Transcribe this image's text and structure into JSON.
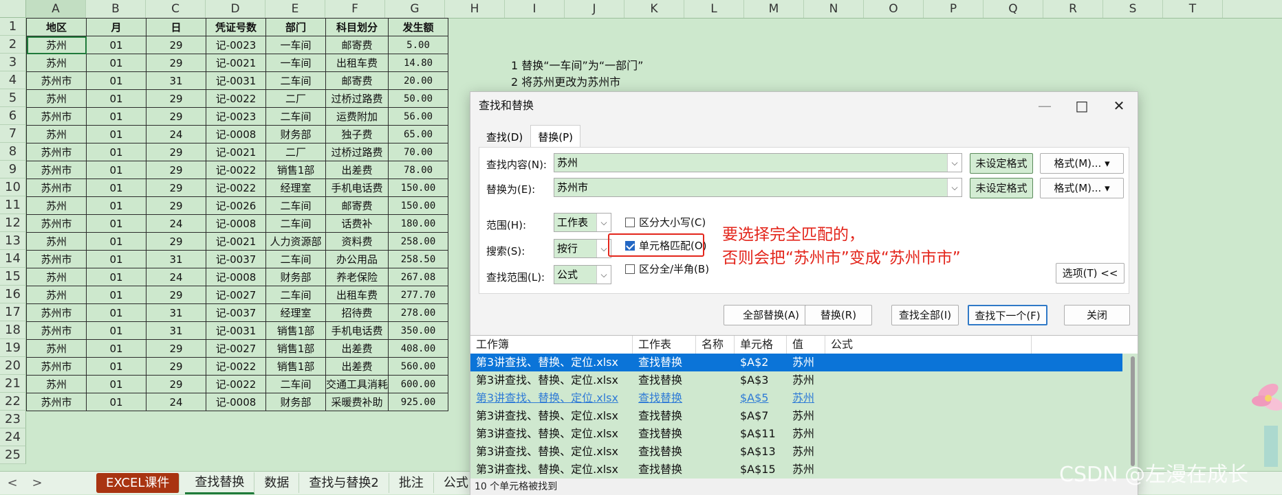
{
  "columns": [
    "A",
    "B",
    "C",
    "D",
    "E",
    "F",
    "G",
    "H",
    "I",
    "J",
    "K",
    "L",
    "M",
    "N",
    "O",
    "P",
    "Q",
    "R",
    "S",
    "T"
  ],
  "rows": [
    "1",
    "2",
    "3",
    "4",
    "5",
    "6",
    "7",
    "8",
    "9",
    "10",
    "11",
    "12",
    "13",
    "14",
    "15",
    "16",
    "17",
    "18",
    "19",
    "20",
    "21",
    "22",
    "23",
    "24",
    "25"
  ],
  "table": {
    "headers": [
      "地区",
      "月",
      "日",
      "凭证号数",
      "部门",
      "科目划分",
      "发生额"
    ],
    "rows": [
      [
        "苏州",
        "01",
        "29",
        "记-0023",
        "一车间",
        "邮寄费",
        "5.00"
      ],
      [
        "苏州",
        "01",
        "29",
        "记-0021",
        "一车间",
        "出租车费",
        "14.80"
      ],
      [
        "苏州市",
        "01",
        "31",
        "记-0031",
        "二车间",
        "邮寄费",
        "20.00"
      ],
      [
        "苏州",
        "01",
        "29",
        "记-0022",
        "二厂",
        "过桥过路费",
        "50.00"
      ],
      [
        "苏州市",
        "01",
        "29",
        "记-0023",
        "二车间",
        "运费附加",
        "56.00"
      ],
      [
        "苏州",
        "01",
        "24",
        "记-0008",
        "财务部",
        "独子费",
        "65.00"
      ],
      [
        "苏州市",
        "01",
        "29",
        "记-0021",
        "二厂",
        "过桥过路费",
        "70.00"
      ],
      [
        "苏州市",
        "01",
        "29",
        "记-0022",
        "销售1部",
        "出差费",
        "78.00"
      ],
      [
        "苏州市",
        "01",
        "29",
        "记-0022",
        "经理室",
        "手机电话费",
        "150.00"
      ],
      [
        "苏州",
        "01",
        "29",
        "记-0026",
        "二车间",
        "邮寄费",
        "150.00"
      ],
      [
        "苏州市",
        "01",
        "24",
        "记-0008",
        "二车间",
        "话费补",
        "180.00"
      ],
      [
        "苏州",
        "01",
        "29",
        "记-0021",
        "人力资源部",
        "资料费",
        "258.00"
      ],
      [
        "苏州市",
        "01",
        "31",
        "记-0037",
        "二车间",
        "办公用品",
        "258.50"
      ],
      [
        "苏州",
        "01",
        "24",
        "记-0008",
        "财务部",
        "养老保险",
        "267.08"
      ],
      [
        "苏州",
        "01",
        "29",
        "记-0027",
        "二车间",
        "出租车费",
        "277.70"
      ],
      [
        "苏州市",
        "01",
        "31",
        "记-0037",
        "经理室",
        "招待费",
        "278.00"
      ],
      [
        "苏州市",
        "01",
        "31",
        "记-0031",
        "销售1部",
        "手机电话费",
        "350.00"
      ],
      [
        "苏州",
        "01",
        "29",
        "记-0027",
        "销售1部",
        "出差费",
        "408.00"
      ],
      [
        "苏州市",
        "01",
        "29",
        "记-0022",
        "销售1部",
        "出差费",
        "560.00"
      ],
      [
        "苏州",
        "01",
        "29",
        "记-0022",
        "二车间",
        "交通工具消耗",
        "600.00"
      ],
      [
        "苏州市",
        "01",
        "24",
        "记-0008",
        "财务部",
        "采暖费补助",
        "925.00"
      ]
    ]
  },
  "notes": [
    "1 替换“一车间”为“一部门”",
    "2 将苏州更改为苏州市"
  ],
  "sheet_tabs": {
    "prev": "<",
    "next": ">",
    "items": [
      "EXCEL课件",
      "查找替换",
      "数据",
      "查找与替换2",
      "批注",
      "公式"
    ]
  },
  "dialog": {
    "title": "查找和替换",
    "minimize": "—",
    "maximize": "□",
    "close": "✕",
    "tab_find": "查找(D)",
    "tab_replace": "替换(P)",
    "find_label": "查找内容(N):",
    "find_value": "苏州",
    "replace_label": "替换为(E):",
    "replace_value": "苏州市",
    "no_format": "未设定格式",
    "format": "格式(M)...",
    "scope_label": "范围(H):",
    "scope_value": "工作表",
    "search_label": "搜索(S):",
    "search_value": "按行",
    "lookin_label": "查找范围(L):",
    "lookin_value": "公式",
    "match_case": "区分大小写(C)",
    "whole_cell": "单元格匹配(O)",
    "full_half": "区分全/半角(B)",
    "options": "选项(T) <<",
    "replace_all": "全部替换(A)",
    "replace": "替换(R)",
    "find_all": "查找全部(I)",
    "find_next": "查找下一个(F)",
    "close_btn": "关闭",
    "result_headers": [
      "工作簿",
      "工作表",
      "名称",
      "单元格",
      "值",
      "公式"
    ],
    "results": [
      [
        "第3讲查找、替换、定位.xlsx",
        "查找替换",
        "",
        "$A$2",
        "苏州",
        ""
      ],
      [
        "第3讲查找、替换、定位.xlsx",
        "查找替换",
        "",
        "$A$3",
        "苏州",
        ""
      ],
      [
        "第3讲查找、替换、定位.xlsx",
        "查找替换",
        "",
        "$A$5",
        "苏州",
        ""
      ],
      [
        "第3讲查找、替换、定位.xlsx",
        "查找替换",
        "",
        "$A$7",
        "苏州",
        ""
      ],
      [
        "第3讲查找、替换、定位.xlsx",
        "查找替换",
        "",
        "$A$11",
        "苏州",
        ""
      ],
      [
        "第3讲查找、替换、定位.xlsx",
        "查找替换",
        "",
        "$A$13",
        "苏州",
        ""
      ],
      [
        "第3讲查找、替换、定位.xlsx",
        "查找替换",
        "",
        "$A$15",
        "苏州",
        ""
      ]
    ],
    "status": "10 个单元格被找到"
  },
  "annotation": [
    "要选择完全匹配的，",
    "否则会把“苏州市”变成“苏州市市”"
  ],
  "watermark": "CSDN @左漫在成长",
  "colors": {
    "accent_red": "#e3251b",
    "selection_blue": "#0b74d8",
    "sheet_green": "#cde8cd"
  }
}
